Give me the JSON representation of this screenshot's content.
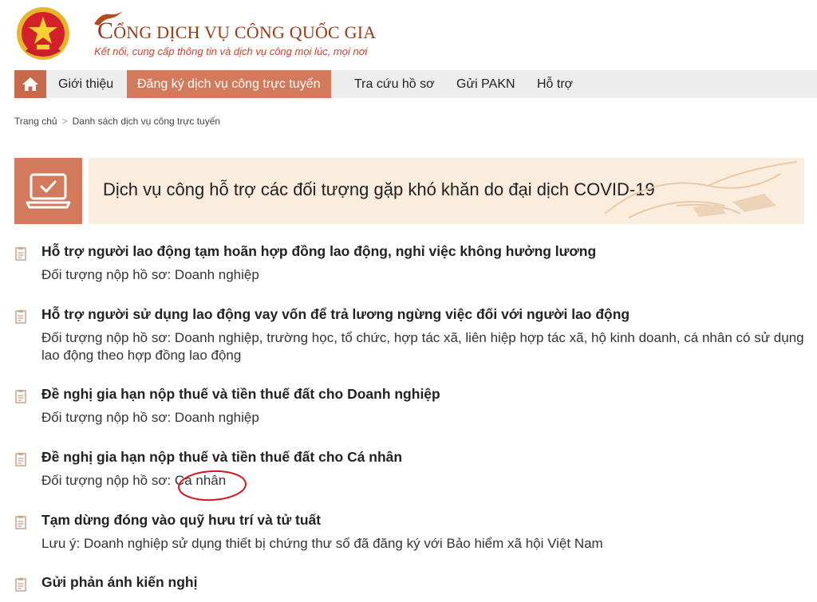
{
  "header": {
    "title_initial": "C",
    "title_rest": "ỔNG DỊCH VỤ CÔNG QUỐC GIA",
    "tagline": "Kết nối, cung cấp thông tin và dịch vụ công mọi lúc, mọi nơi"
  },
  "nav": {
    "home_icon": "home-icon",
    "items": [
      {
        "label": "Giới thiệu"
      },
      {
        "label": "Đăng ký dịch vụ công trực tuyến",
        "active": true
      },
      {
        "label": "Tra cứu hồ sơ"
      },
      {
        "label": "Gửi PAKN"
      },
      {
        "label": "Hỗ trợ"
      }
    ]
  },
  "breadcrumb": {
    "home": "Trang chủ",
    "separator": ">",
    "current": "Danh sách dịch vụ công trực tuyến"
  },
  "banner": {
    "icon": "laptop-check-icon",
    "text": "Dịch vụ công hỗ trợ các đối tượng gặp khó khăn do đại dịch COVID-19"
  },
  "services": [
    {
      "title": "Hỗ trợ người lao động tạm hoãn hợp đồng lao động, nghỉ việc không hưởng lương",
      "desc": "Đối tượng nộp hồ sơ: Doanh nghiệp"
    },
    {
      "title": "Hỗ trợ người sử dụng lao động vay vốn để trả lương ngừng việc đối với người lao động",
      "desc": "Đối tượng nộp hồ sơ: Doanh nghiệp, trường học, tổ chức, hợp tác xã, liên hiệp hợp tác xã, hộ kinh doanh, cá nhân có sử dụng lao động theo hợp đồng lao động"
    },
    {
      "title": "Đề nghị gia hạn nộp thuế và tiền thuế đất cho Doanh nghiệp",
      "desc": "Đối tượng nộp hồ sơ: Doanh nghiệp"
    },
    {
      "title": "Đề nghị gia hạn nộp thuế và tiền thuế đất cho Cá nhân",
      "desc": "Đối tượng nộp hồ sơ: Cá nhân"
    },
    {
      "title": "Tạm dừng đóng vào quỹ hưu trí và tử tuất",
      "desc": "Lưu ý: Doanh nghiệp sử dụng thiết bị chứng thư số đã đăng ký với Bảo hiểm xã hội Việt Nam"
    },
    {
      "title": "Gửi phản ánh kiến nghị",
      "desc": ""
    }
  ],
  "colors": {
    "accent": "#d27a5b",
    "banner_bg": "#fbeddd",
    "title": "#9a3b16",
    "annotation": "#d0161f"
  }
}
